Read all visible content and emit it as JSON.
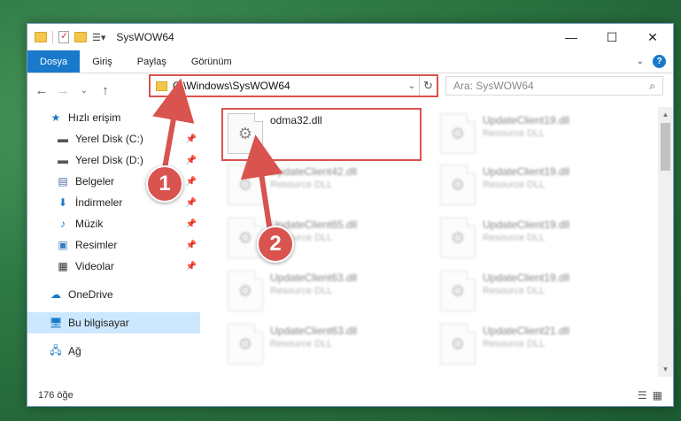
{
  "window": {
    "title": "SysWOW64"
  },
  "controls": {
    "minimize": "—",
    "maximize": "☐",
    "close": "✕"
  },
  "ribbon": {
    "tabs": [
      "Dosya",
      "Giriş",
      "Paylaş",
      "Görünüm"
    ],
    "help": "?"
  },
  "address": {
    "path": "C:\\Windows\\SysWOW64",
    "search_placeholder": "Ara: SysWOW64"
  },
  "sidebar": {
    "quick_access": "Hızlı erişim",
    "items": [
      {
        "label": "Yerel Disk (C:)",
        "icon": "drive-icon"
      },
      {
        "label": "Yerel Disk (D:)",
        "icon": "drive-icon"
      },
      {
        "label": "Belgeler",
        "icon": "documents-icon"
      },
      {
        "label": "İndirmeler",
        "icon": "downloads-icon"
      },
      {
        "label": "Müzik",
        "icon": "music-icon"
      },
      {
        "label": "Resimler",
        "icon": "pictures-icon"
      },
      {
        "label": "Videolar",
        "icon": "videos-icon"
      }
    ],
    "onedrive": "OneDrive",
    "this_pc": "Bu bilgisayar",
    "network": "Ağ"
  },
  "files": [
    {
      "name": "odma32.dll",
      "type": ""
    },
    {
      "name": "UpdateClient19.dll",
      "type": "Resource DLL"
    },
    {
      "name": "UpdateClient42.dll",
      "type": "Resource DLL"
    },
    {
      "name": "UpdateClient19.dll",
      "type": "Resource DLL"
    },
    {
      "name": "UpdateClient65.dll",
      "type": "Resource DLL"
    },
    {
      "name": "UpdateClient19.dll",
      "type": "Resource DLL"
    },
    {
      "name": "UpdateClient63.dll",
      "type": "Resource DLL"
    },
    {
      "name": "UpdateClient19.dll",
      "type": "Resource DLL"
    },
    {
      "name": "UpdateClient63.dll",
      "type": "Resource DLL"
    },
    {
      "name": "UpdateClient21.dll",
      "type": "Resource DLL"
    }
  ],
  "status": {
    "count": "176 öğe"
  },
  "annotations": {
    "step1": "1",
    "step2": "2",
    "color": "#d9534f"
  }
}
